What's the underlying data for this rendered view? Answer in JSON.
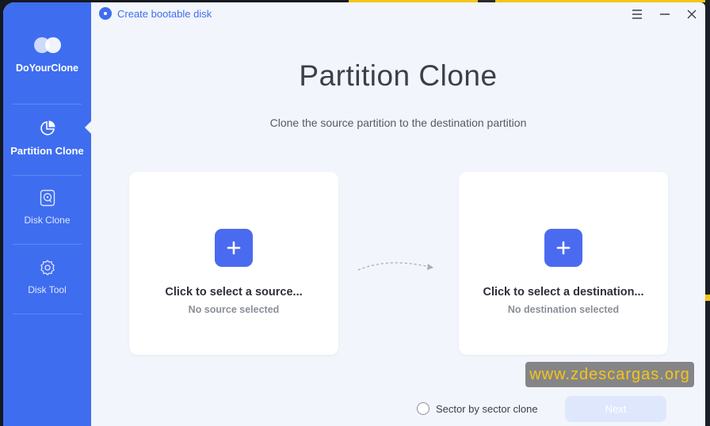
{
  "app": {
    "name": "DoYourClone"
  },
  "titlebar": {
    "bootable_label": "Create bootable disk",
    "menu_icon": "menu-icon",
    "minimize_icon": "minimize-icon",
    "close_icon": "close-icon"
  },
  "sidebar": {
    "items": [
      {
        "label": "Partition Clone",
        "icon": "pie-chart-icon",
        "active": true
      },
      {
        "label": "Disk Clone",
        "icon": "disk-icon",
        "active": false
      },
      {
        "label": "Disk Tool",
        "icon": "gear-icon",
        "active": false
      }
    ]
  },
  "main": {
    "title": "Partition Clone",
    "subtitle": "Clone the source partition to the destination partition",
    "source": {
      "title": "Click to select a source...",
      "status": "No source selected"
    },
    "destination": {
      "title": "Click to select a destination...",
      "status": "No destination selected"
    },
    "sector_option": "Sector by sector clone",
    "next_label": "Next"
  },
  "watermark": "www.zdescargas.org",
  "colors": {
    "accent": "#3f6df0",
    "plus_button": "#4a6bf0",
    "background": "#f2f5fb",
    "next_disabled": "#dfe7fd",
    "watermark_text": "#f5c518"
  }
}
